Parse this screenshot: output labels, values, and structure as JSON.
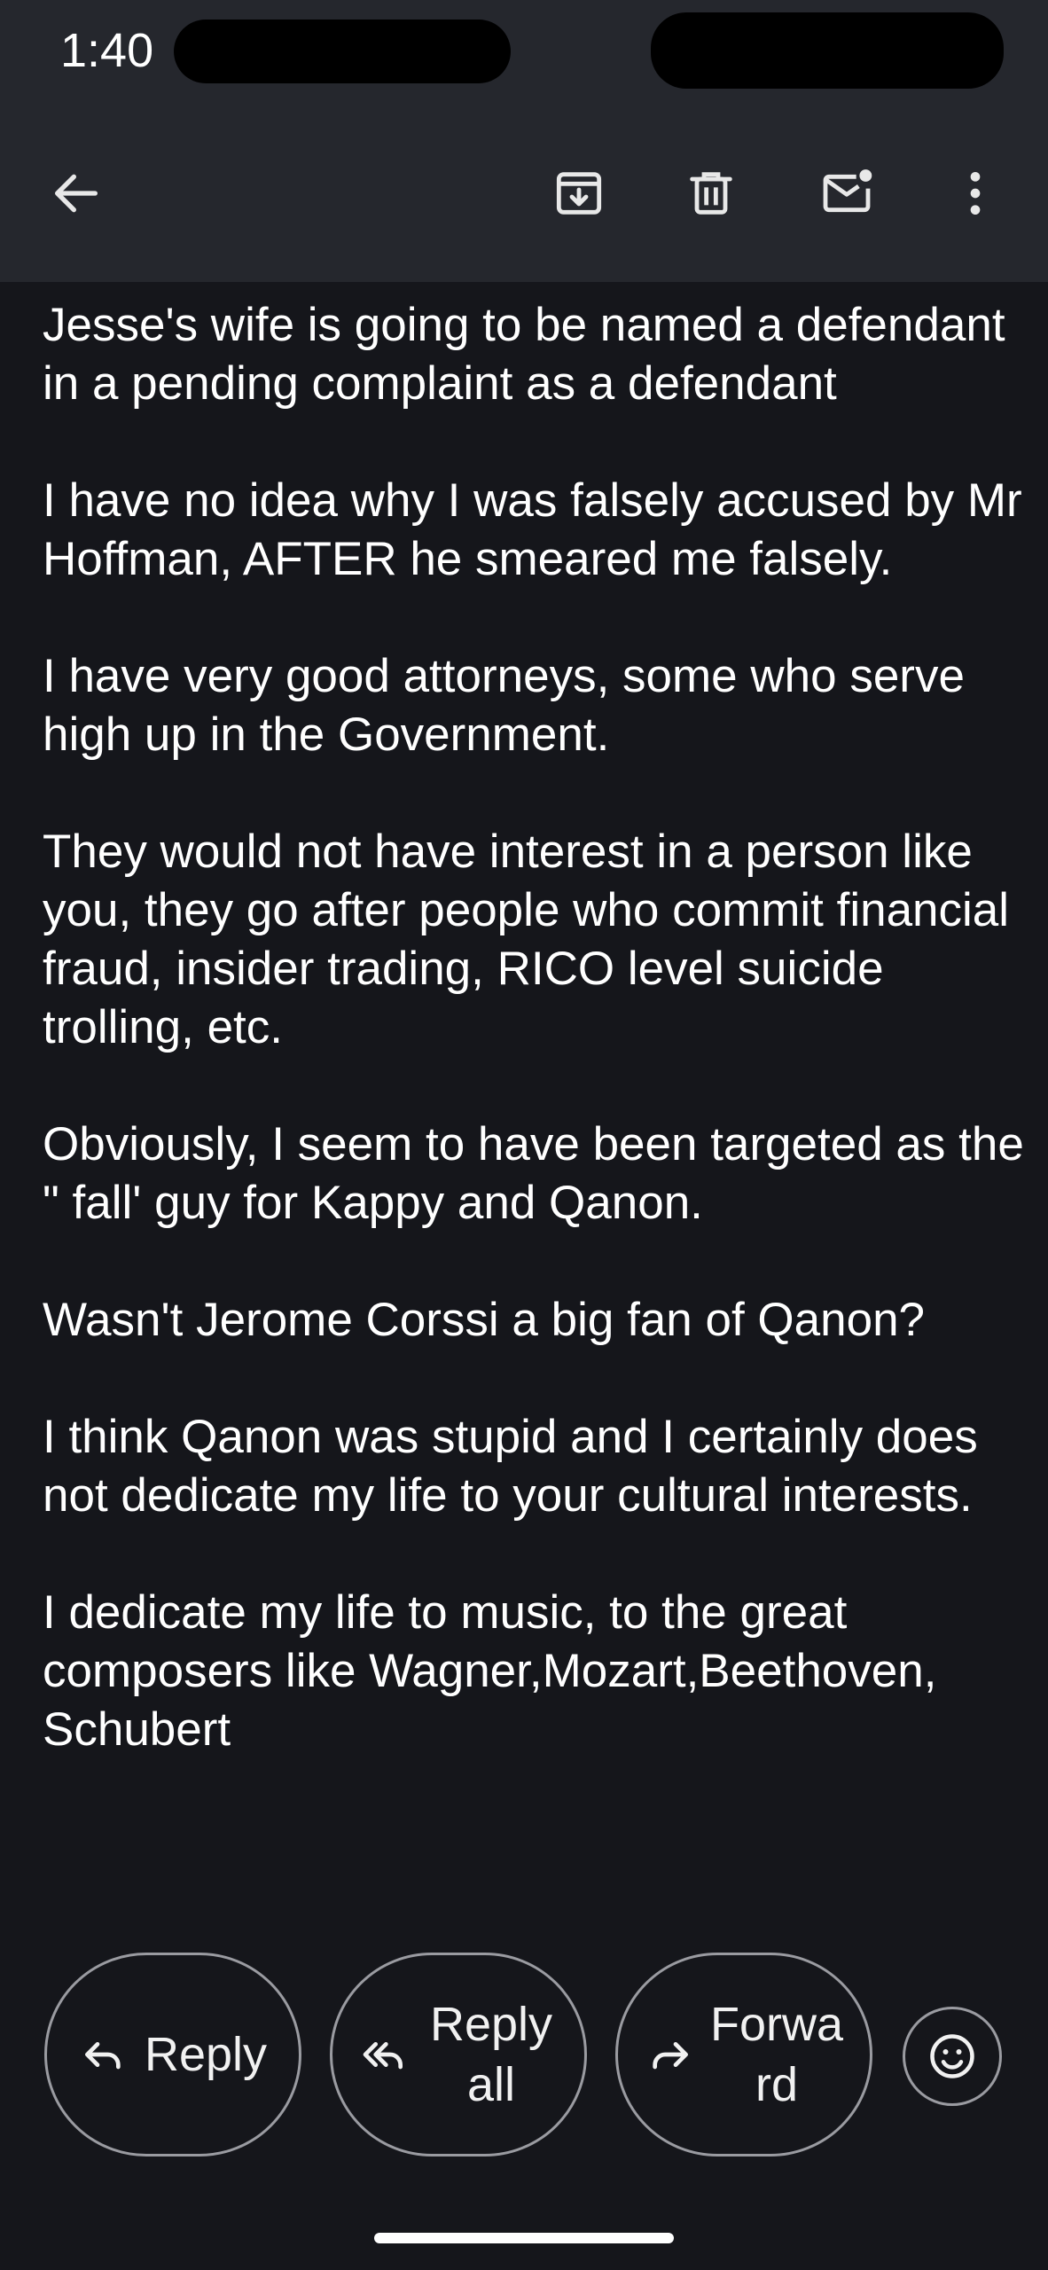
{
  "status_bar": {
    "time": "1:40"
  },
  "toolbar": {
    "back_icon": "arrow-back-icon",
    "archive_icon": "archive-icon",
    "delete_icon": "trash-icon",
    "unread_icon": "mark-unread-icon",
    "more_icon": "more-vert-icon"
  },
  "email": {
    "paragraphs": [
      "Jesse's wife is going to be named a defendant in a pending complaint as a defendant",
      "I have no idea why I was falsely accused by Mr Hoffman, AFTER he smeared me falsely.",
      "I have very good attorneys, some who serve high up in the Government.",
      "They would not have interest in a person like you, they go after people who commit financial fraud, insider trading, RICO level suicide trolling, etc.",
      "Obviously, I seem to have been targeted as the \" fall' guy for Kappy and Qanon.",
      "Wasn't Jerome Corssi a big fan of Qanon?",
      "I think Qanon was stupid and I certainly does not dedicate my life to your cultural interests.",
      "I dedicate my life to music, to the great composers like Wagner,Mozart,Beethoven, Schubert"
    ]
  },
  "actions": {
    "reply_label": "Reply",
    "reply_all_label": "Reply all",
    "forward_label": "Forwa rd",
    "emoji_icon": "emoji-react-icon"
  },
  "colors": {
    "background": "#15161b",
    "app_bar": "#25272d",
    "text": "#ffffff",
    "outline": "#9a9ba1"
  }
}
